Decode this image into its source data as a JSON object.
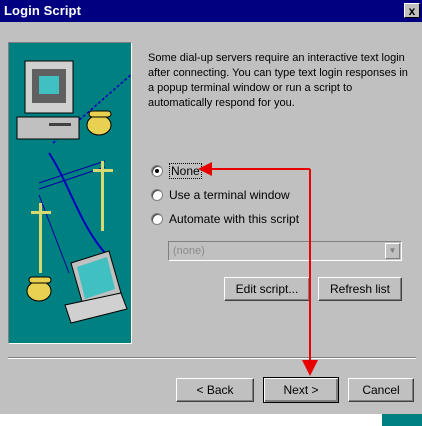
{
  "window": {
    "title": "Login Script",
    "close_symbol": "x"
  },
  "description": "Some dial-up servers require an interactive text login after connecting.  You can type text login responses in a popup terminal window or run a script to automatically respond for you.",
  "options": [
    {
      "label": "None",
      "selected": true
    },
    {
      "label": "Use a terminal window",
      "selected": false
    },
    {
      "label": "Automate with this script",
      "selected": false
    }
  ],
  "script_select": {
    "value": "(none)",
    "enabled": false
  },
  "buttons": {
    "edit_script": "Edit script...",
    "refresh_list": "Refresh list",
    "back": "< Back",
    "next": "Next >",
    "cancel": "Cancel"
  },
  "annotation": {
    "color": "#e60000"
  }
}
